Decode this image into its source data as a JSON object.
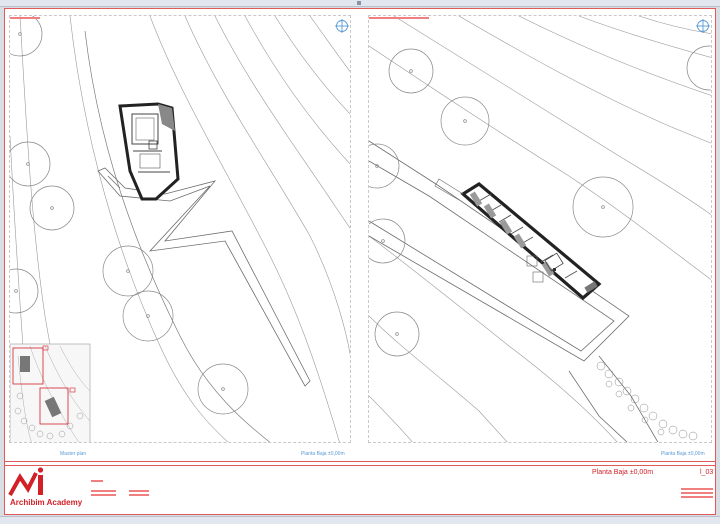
{
  "sheet": {
    "viewports": [
      {
        "id": "master-plan",
        "label": "Master plan",
        "scale_label": "Planta Baja ±0,00m"
      },
      {
        "id": "ground-floor",
        "label": "",
        "scale_label": "Planta Baja ±0,00m"
      }
    ],
    "title_block": {
      "brand": "Archibim Academy",
      "drawing_title": "Planta Baja ±0,00m",
      "sheet_number": "l_03"
    }
  },
  "colors": {
    "accent_red": "#d22027",
    "viewport_label_blue": "#5b9bd5",
    "line_gray": "#8a8a8a"
  },
  "icons": [
    "north-arrow-icon",
    "archibim-logo-icon"
  ]
}
